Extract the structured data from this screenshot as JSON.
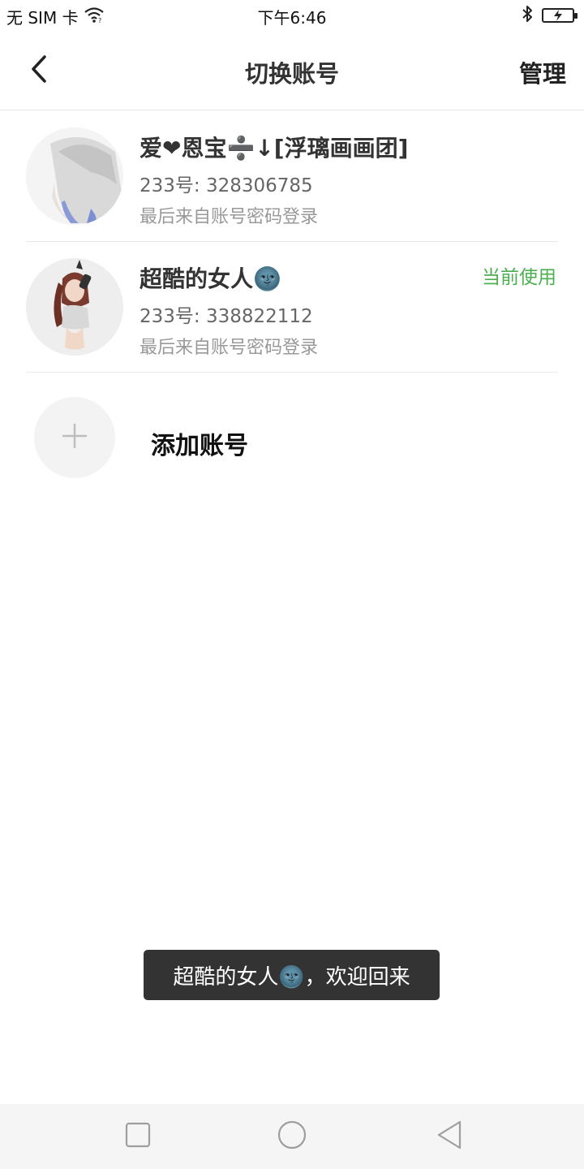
{
  "status_bar": {
    "carrier": "无 SIM 卡",
    "time": "下午6:46"
  },
  "header": {
    "title": "切换账号",
    "manage_label": "管理"
  },
  "accounts": [
    {
      "name": "爱❤恩宝➗↓[浮璃画画团]",
      "id": "233号: 328306785",
      "login": "最后来自账号密码登录",
      "current_label": ""
    },
    {
      "name": "超酷的女人🌚",
      "id": "233号: 338822112",
      "login": "最后来自账号密码登录",
      "current_label": "当前使用"
    }
  ],
  "add_account": {
    "label": "添加账号"
  },
  "toast": {
    "text": "超酷的女人🌚，欢迎回来"
  },
  "colors": {
    "current_status": "#4caf50",
    "toast_bg": "#333333"
  },
  "icons": {
    "back": "chevron-left-icon",
    "wifi": "wifi-icon",
    "bluetooth": "bluetooth-icon",
    "battery": "battery-charging-icon",
    "add": "plus-icon",
    "nav_recent": "square-icon",
    "nav_home": "circle-icon",
    "nav_back": "triangle-back-icon"
  }
}
